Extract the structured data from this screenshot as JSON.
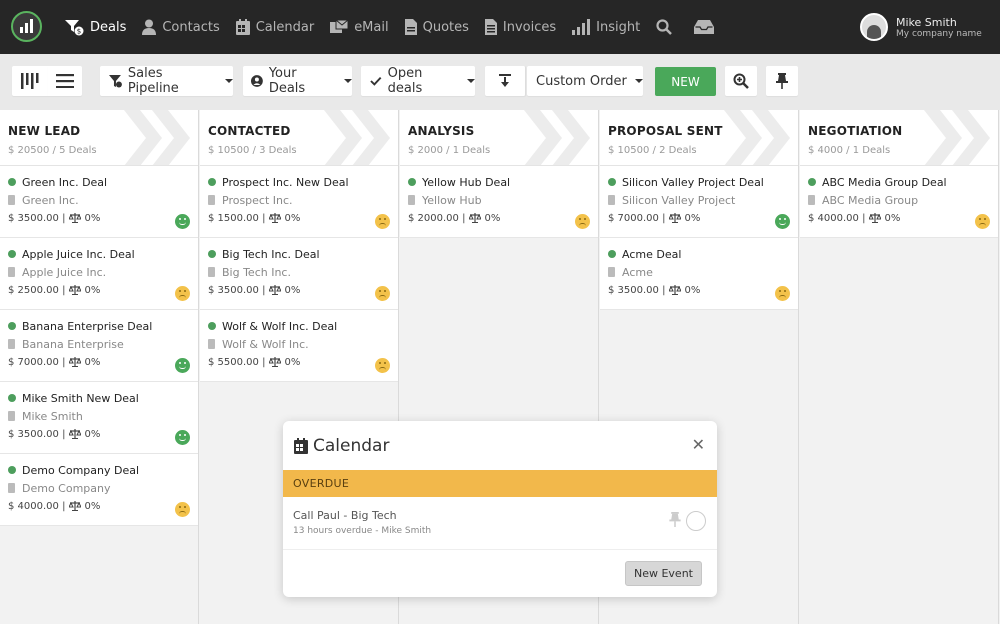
{
  "nav": {
    "items": [
      {
        "label": "Deals",
        "icon": "deals-icon",
        "active": true
      },
      {
        "label": "Contacts",
        "icon": "contacts-icon"
      },
      {
        "label": "Calendar",
        "icon": "calendar-icon"
      },
      {
        "label": "eMail",
        "icon": "email-icon"
      },
      {
        "label": "Quotes",
        "icon": "quotes-icon"
      },
      {
        "label": "Invoices",
        "icon": "invoices-icon"
      },
      {
        "label": "Insight",
        "icon": "insight-icon"
      }
    ]
  },
  "user": {
    "name": "Mike Smith",
    "company": "My company name"
  },
  "toolbar": {
    "pipeline": "Sales Pipeline",
    "owner": "Your Deals",
    "status": "Open deals",
    "order": "Custom Order",
    "new_label": "NEW"
  },
  "columns": [
    {
      "title": "NEW LEAD",
      "summary": "$ 20500 / 5 Deals",
      "deals": [
        {
          "title": "Green Inc. Deal",
          "company": "Green Inc.",
          "value": "$ 3500.00 |",
          "prob": "0%",
          "mood": "happy"
        },
        {
          "title": "Apple Juice Inc. Deal",
          "company": "Apple Juice Inc.",
          "value": "$ 2500.00 |",
          "prob": "0%",
          "mood": "neutral"
        },
        {
          "title": "Banana Enterprise Deal",
          "company": "Banana Enterprise",
          "value": "$ 7000.00 |",
          "prob": "0%",
          "mood": "happy"
        },
        {
          "title": "Mike Smith New Deal",
          "company": "Mike Smith",
          "value": "$ 3500.00 |",
          "prob": "0%",
          "mood": "happy"
        },
        {
          "title": "Demo Company Deal",
          "company": "Demo Company",
          "value": "$ 4000.00 |",
          "prob": "0%",
          "mood": "neutral"
        }
      ]
    },
    {
      "title": "CONTACTED",
      "summary": "$ 10500 / 3 Deals",
      "deals": [
        {
          "title": "Prospect Inc. New Deal",
          "company": "Prospect Inc.",
          "value": "$ 1500.00 |",
          "prob": "0%",
          "mood": "neutral"
        },
        {
          "title": "Big Tech Inc. Deal",
          "company": "Big Tech Inc.",
          "value": "$ 3500.00 |",
          "prob": "0%",
          "mood": "neutral"
        },
        {
          "title": "Wolf & Wolf Inc. Deal",
          "company": "Wolf & Wolf Inc.",
          "value": "$ 5500.00 |",
          "prob": "0%",
          "mood": "neutral"
        }
      ]
    },
    {
      "title": "ANALYSIS",
      "summary": "$ 2000 / 1 Deals",
      "deals": [
        {
          "title": "Yellow Hub Deal",
          "company": "Yellow Hub",
          "value": "$ 2000.00 |",
          "prob": "0%",
          "mood": "neutral"
        }
      ]
    },
    {
      "title": "PROPOSAL SENT",
      "summary": "$ 10500 / 2 Deals",
      "deals": [
        {
          "title": "Silicon Valley Project Deal",
          "company": "Silicon Valley Project",
          "value": "$ 7000.00 |",
          "prob": "0%",
          "mood": "happy"
        },
        {
          "title": "Acme Deal",
          "company": "Acme",
          "value": "$ 3500.00 |",
          "prob": "0%",
          "mood": "neutral"
        }
      ]
    },
    {
      "title": "NEGOTIATION",
      "summary": "$ 4000 / 1 Deals",
      "deals": [
        {
          "title": "ABC Media Group Deal",
          "company": "ABC Media Group",
          "value": "$ 4000.00 |",
          "prob": "0%",
          "mood": "neutral"
        }
      ]
    }
  ],
  "calendar_popup": {
    "title": "Calendar",
    "section": "OVERDUE",
    "event_title": "Call Paul - Big Tech",
    "event_sub": "13 hours overdue - Mike Smith",
    "new_event_label": "New Event"
  },
  "colors": {
    "topbar": "#262626",
    "accent_green": "#4aa85a",
    "overdue": "#f2b84b"
  }
}
